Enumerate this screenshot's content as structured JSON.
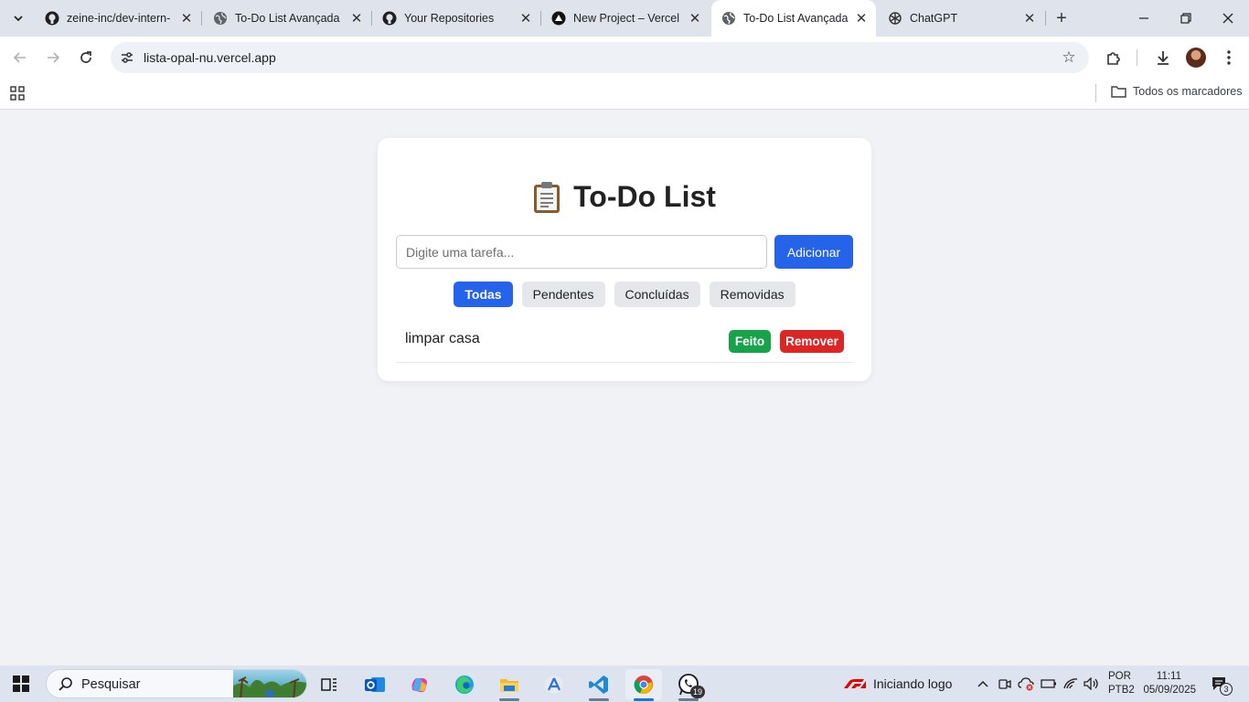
{
  "browser": {
    "tabs": [
      {
        "title": "zeine-inc/dev-intern-",
        "favicon": "github-icon",
        "active": false
      },
      {
        "title": "To-Do List Avançada",
        "favicon": "globe-icon",
        "active": false
      },
      {
        "title": "Your Repositories",
        "favicon": "github-icon",
        "active": false
      },
      {
        "title": "New Project – Vercel",
        "favicon": "vercel-icon",
        "active": false
      },
      {
        "title": "To-Do List Avançada",
        "favicon": "globe-icon",
        "active": true
      },
      {
        "title": "ChatGPT",
        "favicon": "openai-icon",
        "active": false
      }
    ],
    "url": "lista-opal-nu.vercel.app",
    "bookmarks_folder": "Todos os marcadores"
  },
  "app": {
    "title": "To-Do List",
    "title_icon": "clipboard-icon",
    "input_placeholder": "Digite uma tarefa...",
    "input_value": "",
    "add_label": "Adicionar",
    "filters": [
      {
        "label": "Todas",
        "active": true
      },
      {
        "label": "Pendentes",
        "active": false
      },
      {
        "label": "Concluídas",
        "active": false
      },
      {
        "label": "Removidas",
        "active": false
      }
    ],
    "tasks": [
      {
        "text": "limpar casa",
        "done_label": "Feito",
        "remove_label": "Remover"
      }
    ],
    "colors": {
      "primary": "#2563eb",
      "done": "#16a34a",
      "remove": "#dc2626"
    }
  },
  "taskbar": {
    "search_label": "Pesquisar",
    "apps": [
      "task-view-icon",
      "outlook-icon",
      "copilot-icon",
      "edge-icon",
      "file-explorer-icon",
      "app-store-icon",
      "vscode-icon",
      "chrome-icon",
      "whatsapp-icon"
    ],
    "whatsapp_badge": "19",
    "tray_status": "Iniciando logo",
    "lang_line1": "POR",
    "lang_line2": "PTB2",
    "time": "11:11",
    "date": "05/09/2025",
    "notification_count": "3"
  }
}
